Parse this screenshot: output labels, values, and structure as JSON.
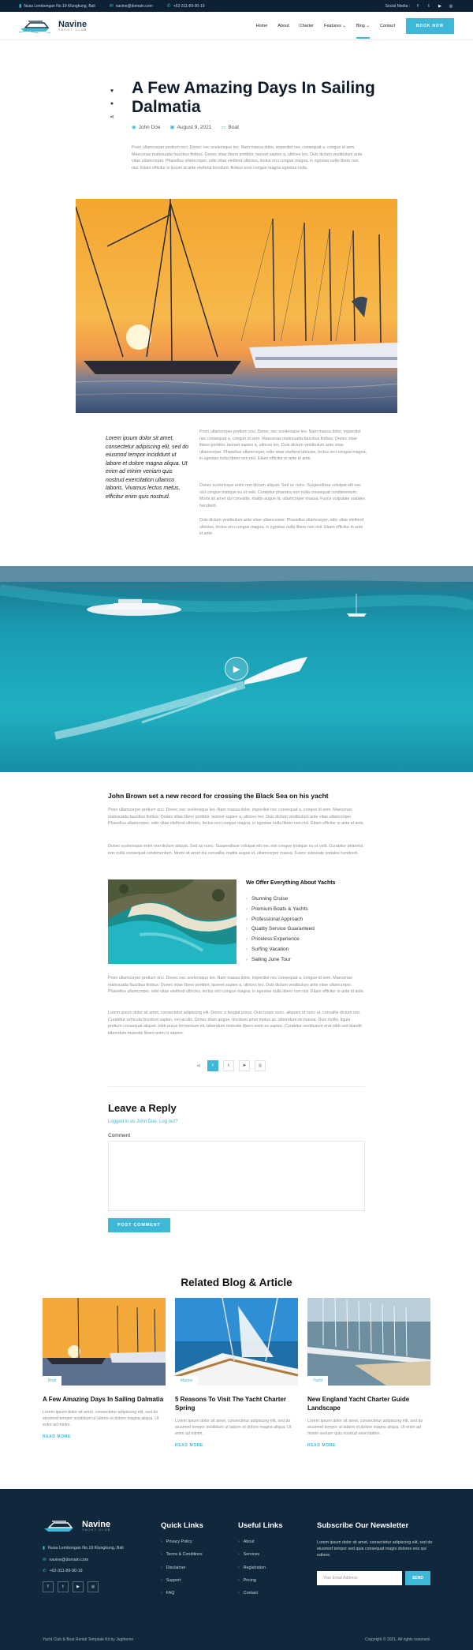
{
  "topbar": {
    "address": "Nusa Lembongan No.19 Klungkung, Bali",
    "email": "navine@domain.com",
    "phone": "+62-311-89-90-19",
    "social_label": "Social Media :"
  },
  "header": {
    "logo_name": "Navine",
    "logo_sub": "YACHT CLUB",
    "nav": [
      "Home",
      "About",
      "Charter",
      "Features",
      "Blog",
      "Contact"
    ],
    "book_label": "BOOK NOW"
  },
  "article": {
    "title": "A Few Amazing Days In Sailing Dalmatia",
    "author": "John Doe",
    "date": "August 9, 2021",
    "category": "Boat",
    "intro": "Proin ullamcorper pretium orci. Donec nec scelerisque leo. Nam massa dolor, imperdiet nec consequat a, congue id sem. Maecenas malesuada faucibus finibus. Donec vitae libero porttitor, laoreet sapien a, ultrices leo. Duis dictum vestibulum ante vitae ullamcorper. Phasellus ullamcorper, odio vitae eleifend ultricies, lectus orci congue magna, in egestas nulla libero non nisl. Etiam efficitur in ipsum id ante eleifend tincidunt, finibus eros congue magna egestas nulla.",
    "quote": "Lorem ipsum dolor sit amet, consectetur adipiscing elit, sed do eiusmod tempor incididunt ut labore et dolore magna aliqua. Ut enim ad minim veniam quis nostrud exercitation ullamco laboris. Vivamus lectus metus, efficitur enim quis nostrud.",
    "side_p1": "Proin ullamcorper pretium orci. Donec nec scelerisque leo. Nam massa dolor, imperdiet nec consequat a, congue id sem. Maecenas malesuada faucibus finibus. Donec vitae libero porttitor, laoreet sapien a, ultrices leo. Duis dictum vestibulum ante vitae ullamcorper. Phasellus ullamcorper, odio vitae eleifend ultricies, lectus orci congue magna, in egestas nulla libero non nisl. Etiam efficitur in ante id ante.",
    "side_p2": "Donec scelerisque enim non dictum aliquet. Sed ac nunc. Suspendisse volutpat elit nec nisi congue tristique eu et velit. Curabitur pharetra non nulla consequat condimentum. Morbi sit amet dui convallis, mattis augue id, ullamcorper massa. Fusce vulputate sodales hendrerit.",
    "side_p3": "Duis dictum vestibulum ante vitae ullamcorper. Phasellus ullamcorper, odio vitae eleifend ultricies, lectus orci congue magna, in egestas nulla libero non nisl. Etiam efficitur in ante id ante."
  },
  "section2": {
    "heading": "John Brown set a new record for crossing the Black Sea on his yacht",
    "p1": "Proin ullamcorper pretium orci. Donec nec scelerisque leo. Nam massa dolor, imperdiet nec consequat a, congue id sem. Maecenas malesuada faucibus finibus. Donec vitae libero porttitor, laoreet sapien a, ultrices leo. Duis dictum vestibulum ante vitae ullamcorper. Phasellus ullamcorper, odio vitae eleifend ultricies, lectus orci congue magna, in egestas nulla libero non nisl. Etiam efficitur in ante id ante.",
    "p2": "Donec scelerisque enim non dictum aliquet. Sed ac nunc. Suspendisse volutpat elit nec nisi congue tristique eu et velit. Curabitur pharetra non nulla consequat condimentum. Morbi sit amet dui convallis, mattis augue id, ullamcorper massa. Fusce vulputate sodales hendrerit.",
    "offer_heading": "We Offer Everything About Yachts",
    "offers": [
      "Stunning Cruise",
      "Premium Boats & Yachts",
      "Professional Approach",
      "Quality Service Guaranteed",
      "Priceless Experience",
      "Surfing Vacation",
      "Sailing June Tour"
    ],
    "p3": "Proin ullamcorper pretium orci. Donec nec scelerisque leo. Nam massa dolor, imperdiet nec consequat a, congue id sem. Maecenas malesuada faucibus finibus. Donec vitae libero porttitor, laoreet sapien a, ultrices leo. Duis dictum vestibulum ante vitae ullamcorper. Phasellus ullamcorper, odio vitae eleifend ultricies, lectus orci congue magna, in egestas nulla libero non nisl. Etiam efficitur in ante id ante.",
    "p4": "Lorem ipsum dolor sit amet, consectetur adipiscing elit. Donec a feugiat purus. Duis turpis nunc, aliquam id nunc ut, convallis dictum nisi. Curabitur vehicula tincidunt sapien, vel iaculis. Donec diam augue, tincidunt amet metus ac, bibendum mi massa. Duis mollis, ligula pretium consequat aliquet, nibh purus fermentum mi, bibendum molestie libero enim ex sapien. Curabitur vestibulum erat nibh sed blandit bibendum molestie libero enim in sapien."
  },
  "reply": {
    "heading": "Leave a Reply",
    "logged_in": "Logged in as John Doe. Log out?",
    "comment_label": "Comment",
    "post_label": "POST COMMENT"
  },
  "related": {
    "heading": "Related Blog & Article",
    "cards": [
      {
        "tag": "Boat",
        "title": "A Few Amazing Days In Sailing Dalmatia",
        "text": "Lorem ipsum dolor sit amet, consectetur adipiscing elit, sed do eiusmod tempor incididunt ut labore et dolore magna aliqua. Ut enim ad minim.",
        "more": "READ MORE"
      },
      {
        "tag": "Marine",
        "title": "5 Reasons To Visit The Yacht Charter Spring",
        "text": "Lorem ipsum dolor sit amet, consectetur adipiscing elit, sed do eiusmod tempor incididunt ut labore et dolore magna aliqua. Ut enim ad minim.",
        "more": "READ MORE"
      },
      {
        "tag": "Yacht",
        "title": "New England Yacht Charter Guide Landscape",
        "text": "Lorem ipsum dolor sit amet, consectetur adipiscing elit, sed do eiusmod tempor ut labore et dolore magna aliqua. Ut enim ad minim veniam quis nostrud exercitation.",
        "more": "READ MORE"
      }
    ]
  },
  "footer": {
    "logo_name": "Navine",
    "logo_sub": "YACHT CLUB",
    "address": "Nusa Lembongan No.19 Klungkung, Bali",
    "email": "navine@domain.com",
    "phone": "+62-311-89-90-19",
    "quick_heading": "Quick Links",
    "quick": [
      "Privacy Policy",
      "Terms & Conditions",
      "Disclaimer",
      "Support",
      "FAQ"
    ],
    "useful_heading": "Useful Links",
    "useful": [
      "About",
      "Services",
      "Registration",
      "Pricing",
      "Contact"
    ],
    "newsletter_heading": "Subscribe Our Newsletter",
    "newsletter_text": "Lorem ipsum dolor sit amet, consectetur adipiscing elit, sed do eiusmod tempor sed quia consequat magni dolores eos qui ratione.",
    "email_placeholder": "Your Email Address",
    "send_label": "SEND",
    "credit": "Yacht Club & Boat Rental Template Kit by Jegtheme",
    "copyright": "Copyright © 2021. All rights reserved."
  },
  "colors": {
    "accent": "#3db8d6",
    "dark": "#11283c",
    "topbar": "#0e2033"
  }
}
